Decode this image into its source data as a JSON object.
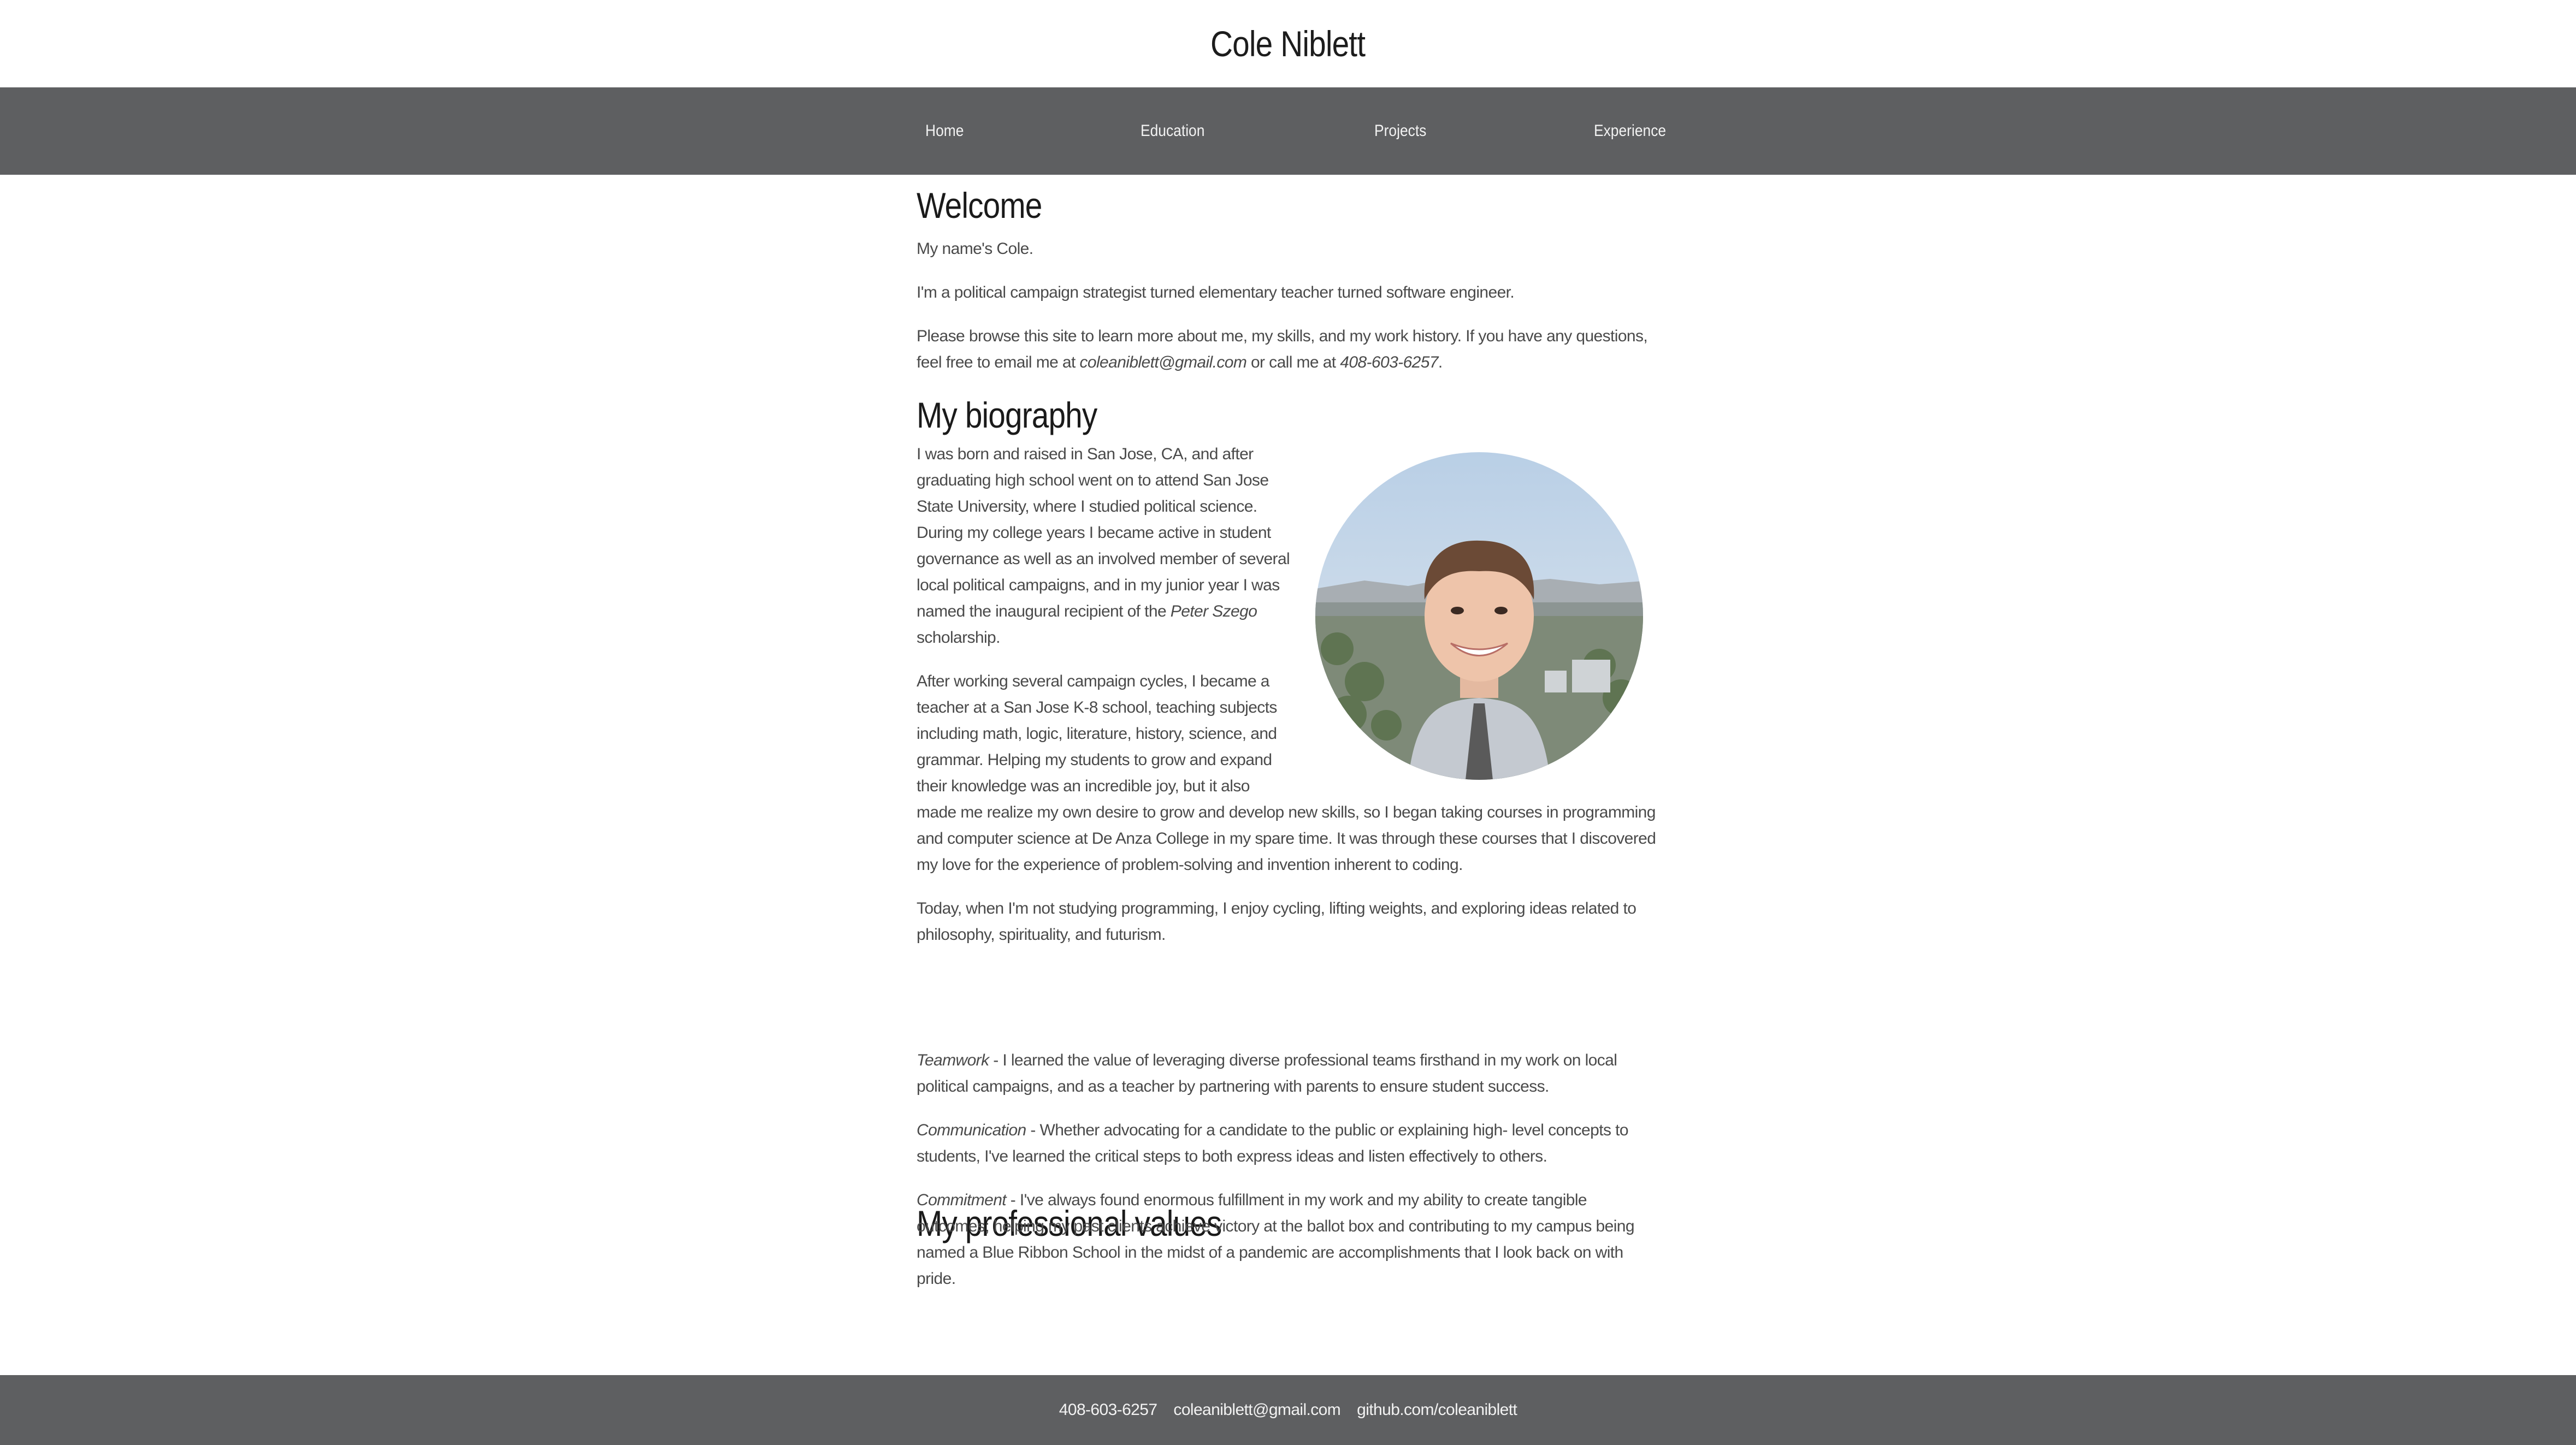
{
  "header": {
    "title": "Cole Niblett"
  },
  "nav": {
    "items": [
      {
        "label": "Home"
      },
      {
        "label": "Education"
      },
      {
        "label": "Projects"
      },
      {
        "label": "Experience"
      }
    ]
  },
  "welcome": {
    "heading": "Welcome",
    "name_line": "My name's Cole.",
    "intro": "I'm a political campaign strategist turned elementary teacher turned software engineer.",
    "browse_a": "Please browse this site to learn more about me, my skills, and my work history. If you have any questions, feel free to email me at ",
    "email": "coleaniblett@gmail.com",
    "browse_b": " or call me at ",
    "phone": "408-603-6257",
    "browse_c": "."
  },
  "biography": {
    "heading": "My biography",
    "p1_a": "I was born and raised in San Jose, CA, and after graduating high school went on to attend San Jose State University, where I studied political science. During my college years I became active in student governance as well as an involved member of several local political campaigns, and in my junior year I was named the inaugural recipient of the ",
    "p1_em": "Peter Szego",
    "p1_b": " scholarship.",
    "p2": "After working several campaign cycles, I became a teacher at a San Jose K-8 school, teaching subjects including math, logic, literature, history, science, and grammar. Helping my students to grow and expand their knowledge was an incredible joy, but it also made me realize my own desire to grow and develop new skills, so I began taking courses in programming and computer science at De Anza College in my spare time. It was through these courses that I discovered my love for the experience of problem-solving and invention inherent to coding.",
    "p3": "Today, when I'm not studying programming, I enjoy cycling, lifting weights, and exploring ideas related to philosophy, spirituality, and futurism."
  },
  "values": {
    "heading": "My professional values",
    "items": [
      {
        "title": "Teamwork",
        "text": " - I learned the value of leveraging diverse professional teams firsthand in my work on local political campaigns, and as a teacher by partnering with parents to ensure student success."
      },
      {
        "title": "Communication",
        "text": " - Whether advocating for a candidate to the public or explaining high- level concepts to students, I've learned the critical steps to both express ideas and listen effectively to others."
      },
      {
        "title": "Commitment",
        "text": " - I've always found enormous fulfillment in my work and my ability to create tangible outcomes; helping my past clients achieve victory at the ballot box and contributing to my campus being named a Blue Ribbon School in the midst of a pandemic are accomplishments that I look back on with pride."
      }
    ]
  },
  "footer": {
    "phone": "408-603-6257",
    "email": "coleaniblett@gmail.com",
    "github": "github.com/coleaniblett"
  },
  "colors": {
    "nav_bg": "#5e5f61",
    "footer_bg": "#5e5f61",
    "nav_text": "#f2f2f2",
    "heading": "#1a1a1a",
    "body_text": "#4a4a4a"
  }
}
